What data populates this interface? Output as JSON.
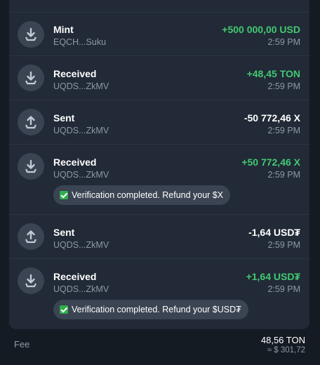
{
  "transactions": [
    {
      "type": "Mint",
      "address": "EQCH...Suku",
      "amount": "+500 000,00 USD",
      "time": "2:59 PM",
      "direction": "in",
      "icon": "arrow-down-icon",
      "amount_color": "#43c872"
    },
    {
      "type": "Received",
      "address": "UQDS...ZkMV",
      "amount": "+48,45 TON",
      "time": "2:59 PM",
      "direction": "in",
      "icon": "arrow-down-icon",
      "amount_color": "#43c872"
    },
    {
      "type": "Sent",
      "address": "UQDS...ZkMV",
      "amount": "-50 772,46 X",
      "time": "2:59 PM",
      "direction": "out",
      "icon": "arrow-up-icon",
      "amount_color": "#ffffff"
    },
    {
      "type": "Received",
      "address": "UQDS...ZkMV",
      "amount": "+50 772,46 X",
      "time": "2:59 PM",
      "direction": "in",
      "icon": "arrow-down-icon",
      "amount_color": "#43c872",
      "comment": "Verification completed. Refund your $X"
    },
    {
      "type": "Sent",
      "address": "UQDS...ZkMV",
      "amount": "-1,64 USD₮",
      "time": "2:59 PM",
      "direction": "out",
      "icon": "arrow-up-icon",
      "amount_color": "#ffffff"
    },
    {
      "type": "Received",
      "address": "UQDS...ZkMV",
      "amount": "+1,64 USD₮",
      "time": "2:59 PM",
      "direction": "in",
      "icon": "arrow-down-icon",
      "amount_color": "#43c872",
      "comment": "Verification completed. Refund your $USD₮"
    }
  ],
  "fee": {
    "label": "Fee",
    "value": "48,56 TON",
    "fiat": "≈ $ 301,72"
  },
  "colors": {
    "background": "#151b23",
    "card": "#212a36",
    "positive": "#43c872",
    "secondary_text": "#8e99a6",
    "check_emoji": "#2fae4b"
  }
}
